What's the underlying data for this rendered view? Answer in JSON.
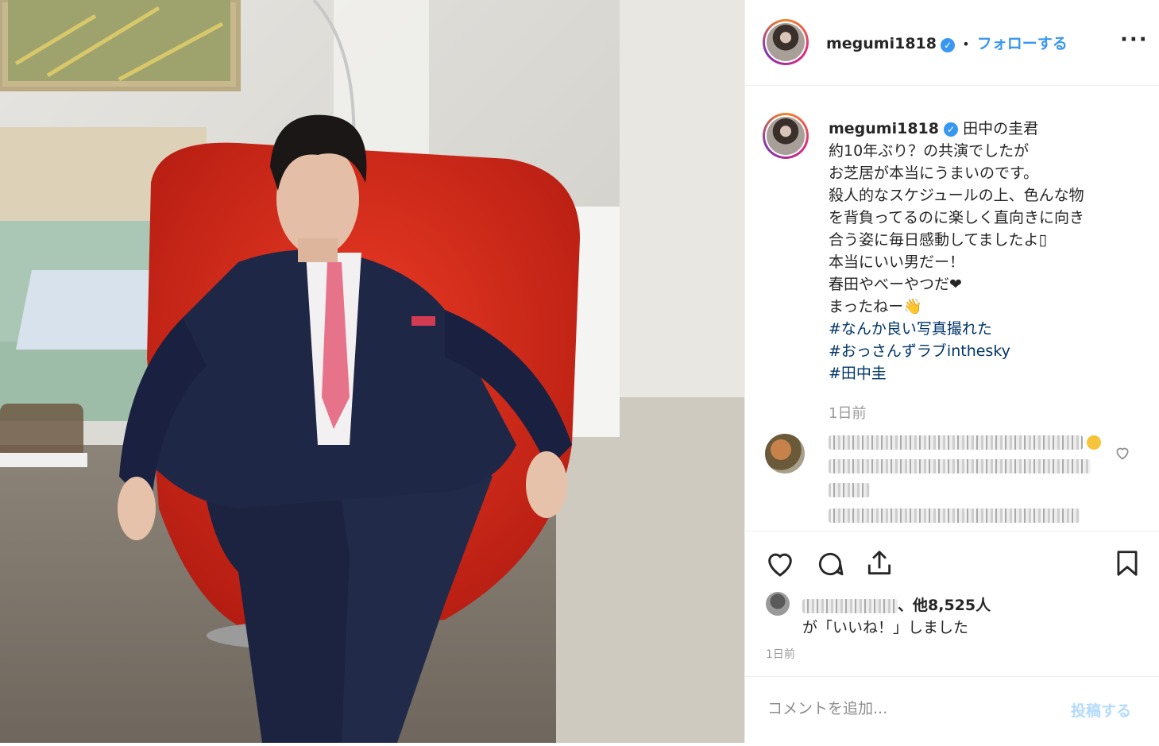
{
  "header": {
    "username": "megumi1818",
    "separator": "•",
    "follow_label": "フォローする",
    "more_icon": "more-horizontal-icon"
  },
  "caption": {
    "username": "megumi1818",
    "lines": [
      "田中の圭君",
      "約10年ぶり？の共演でしたが",
      "お芝居が本当にうまいのです。",
      "殺人的なスケジュールの上、色んな物",
      "を背負ってるのに楽しく直向きに向き",
      "合う姿に毎日感動してましたよ▯",
      "本当にいい男だー！",
      "春田やべーやつだ❤",
      "まったねー👋"
    ],
    "hashtags": [
      "#なんか良い写真撮れた",
      "#おっさんずラブinthesky",
      "#田中圭"
    ],
    "time_ago": "1日前"
  },
  "comment": {
    "heart_icon": "heart-outline-icon"
  },
  "actions": {
    "icons": [
      "heart-outline-icon",
      "comment-icon",
      "share-icon",
      "bookmark-icon"
    ],
    "likes_suffix": "、他8,525人",
    "likes_line2": "が「いいね！」しました",
    "timestamp": "1日前"
  },
  "comment_box": {
    "placeholder": "コメントを追加...",
    "post_label": "投稿する"
  },
  "colors": {
    "accent": "#3897f0",
    "hashtag": "#003569",
    "chair_red": "#d92b1c",
    "suit_navy": "#1c2340",
    "tie_pink": "#e7738a"
  }
}
